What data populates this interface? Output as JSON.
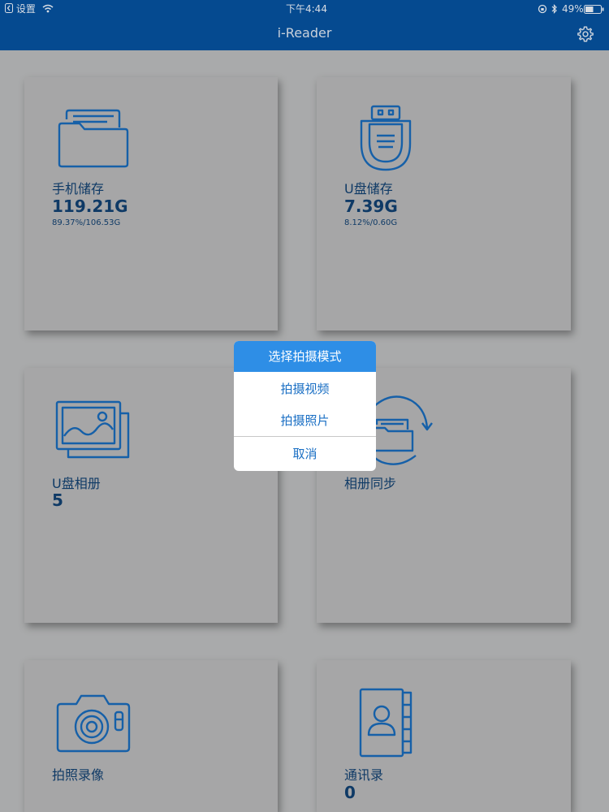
{
  "status_bar": {
    "back_app": "设置",
    "time": "下午4:44",
    "battery": "49%"
  },
  "header": {
    "title": "i-Reader"
  },
  "tiles": {
    "phone_storage": {
      "label": "手机储存",
      "value": "119.21G",
      "detail": "89.37%/106.53G"
    },
    "usb_storage": {
      "label": "U盘储存",
      "value": "7.39G",
      "detail": "8.12%/0.60G"
    },
    "usb_album": {
      "label": "U盘相册",
      "value": "5"
    },
    "album_sync": {
      "label": "相册同步"
    },
    "camera": {
      "label": "拍照录像"
    },
    "contacts": {
      "label": "通讯录",
      "value": "0"
    }
  },
  "action_sheet": {
    "title": "选择拍摄模式",
    "options": [
      "拍摄视频",
      "拍摄照片"
    ],
    "cancel": "取消"
  },
  "colors": {
    "nav_bar": "#054a90",
    "icon_blue": "#1660a8",
    "sheet_title_bg": "#2e8ee6",
    "sheet_text": "#1a6fc4"
  }
}
